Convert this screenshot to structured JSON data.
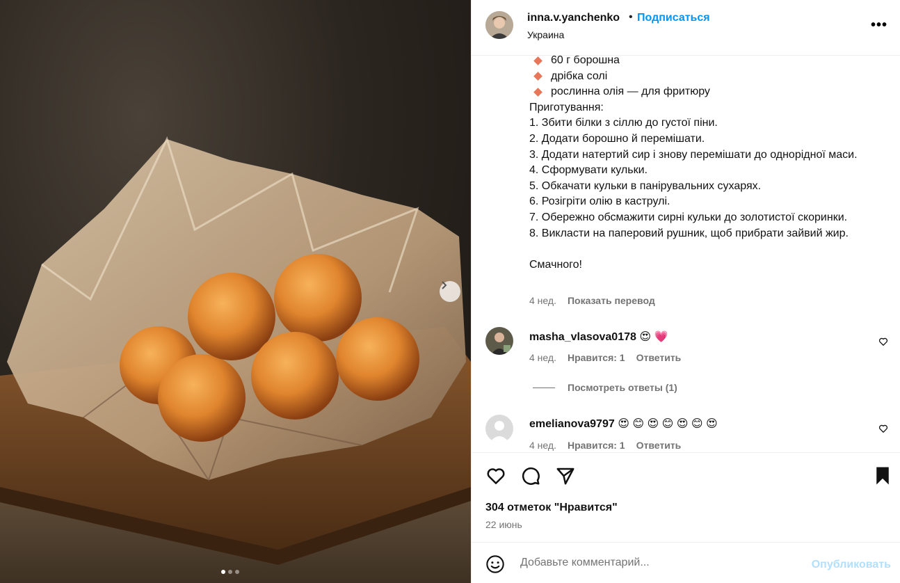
{
  "post": {
    "username": "inna.v.yanchenko",
    "separator": "•",
    "follow_label": "Подписаться",
    "location": "Украина",
    "more_label": "•••"
  },
  "caption": {
    "ingredients": [
      "60 г борошна",
      "дрібка солі",
      "рослинна олія — для фритюру"
    ],
    "steps_title": "Приготування:",
    "steps": [
      "1. Збити білки з сіллю до густої піни.",
      "2. Додати борошно й перемішати.",
      "3. Додати натертий сир і знову перемішати до однорідної маси.",
      "4. Сформувати кульки.",
      "5. Обкачати кульки в панірувальних сухарях.",
      "6. Розігріти олію в каструлі.",
      "7. Обережно обсмажити сирні кульки до золотистої скоринки.",
      "8. Викласти на паперовий рушник, щоб прибрати зайвий жир."
    ],
    "closing": "Смачного!",
    "age": "4 нед.",
    "translate_label": "Показать перевод"
  },
  "comments": [
    {
      "username": "masha_vlasova0178",
      "emoji": "😍 💗",
      "age": "4 нед.",
      "likes_label": "Нравится: 1",
      "reply_label": "Ответить",
      "view_replies_label": "Посмотреть ответы (1)"
    },
    {
      "username": "emelianova9797",
      "emoji": "😍 😊 😍 😊 😍 😊 😍",
      "age": "4 нед.",
      "likes_label": "Нравится: 1",
      "reply_label": "Ответить"
    }
  ],
  "actions": {
    "likes_text": "304 отметок \"Нравится\"",
    "date": "22 июнь"
  },
  "comment_box": {
    "placeholder": "Добавьте комментарий...",
    "publish_label": "Опубликовать"
  },
  "carousel": {
    "slide_count": 3,
    "active_index": 0
  },
  "colors": {
    "follow": "#0095f6",
    "muted": "#737373",
    "publish_disabled": "#b2dffc",
    "bullet": "#e8775a"
  }
}
